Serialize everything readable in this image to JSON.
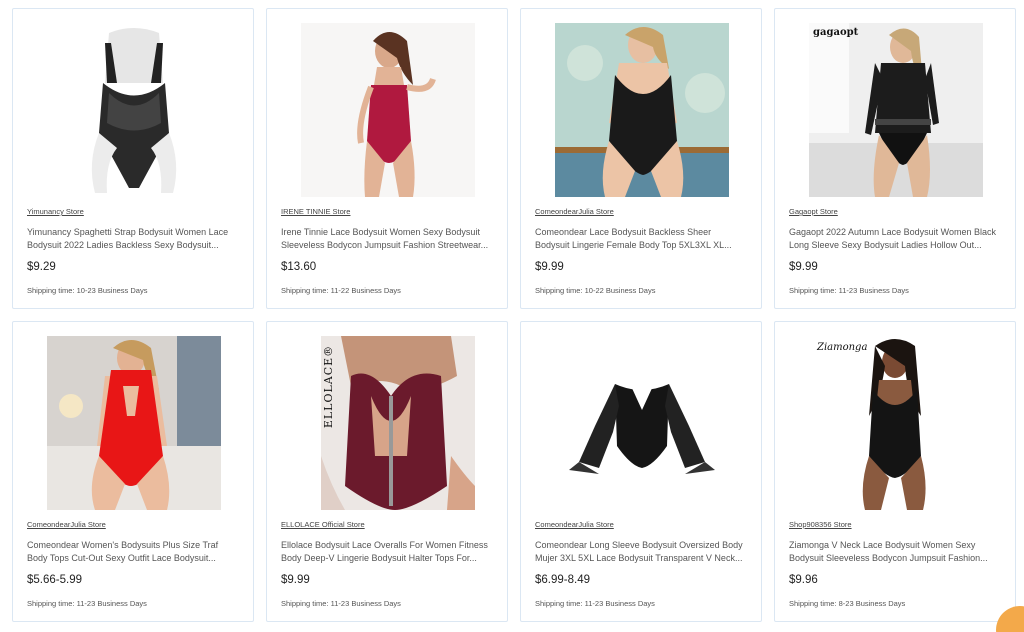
{
  "products": [
    {
      "store": "Yimunancy Store",
      "title": "Yimunancy Spaghetti Strap Bodysuit Women Lace Bodysuit 2022 Ladies Backless Sexy Bodysuit...",
      "price": "$9.29",
      "shipping": "Shipping time: 10-23 Business Days"
    },
    {
      "store": "IRENE TINNIE Store",
      "title": "Irene Tinnie Lace Bodysuit Women Sexy Bodysuit Sleeveless Bodycon Jumpsuit Fashion Streetwear...",
      "price": "$13.60",
      "shipping": "Shipping time: 11-22 Business Days"
    },
    {
      "store": "ComeondearJulia Store",
      "title": "Comeondear Lace Bodysuit Backless Sheer Bodysuit Lingerie Female Body Top 5XL3XL XL...",
      "price": "$9.99",
      "shipping": "Shipping time: 10-22 Business Days"
    },
    {
      "store": "Gagaopt Store",
      "title": "Gagaopt 2022 Autumn Lace Bodysuit Women Black Long Sleeve Sexy Bodysuit Ladies Hollow Out...",
      "price": "$9.99",
      "shipping": "Shipping time: 11-23 Business Days",
      "logo": "gagaopt"
    },
    {
      "store": "ComeondearJulia Store",
      "title": "Comeondear Women's Bodysuits Plus Size Traf Body Tops Cut-Out Sexy Outfit Lace Bodysuit...",
      "price": "$5.66-5.99",
      "shipping": "Shipping time: 11-23 Business Days"
    },
    {
      "store": "ELLOLACE Official Store",
      "title": "Ellolace Bodysuit Lace Overalls For Women Fitness Body Deep-V Lingerie Bodysuit Halter Tops For...",
      "price": "$9.99",
      "shipping": "Shipping time: 11-23 Business Days",
      "logo": "ELLOLACE®"
    },
    {
      "store": "ComeondearJulia Store",
      "title": "Comeondear Long Sleeve Bodysuit Oversized Body Mujer 3XL 5XL Lace Bodysuit Transparent V Neck...",
      "price": "$6.99-8.49",
      "shipping": "Shipping time: 11-23 Business Days"
    },
    {
      "store": "Shop908356 Store",
      "title": "Ziamonga V Neck Lace Bodysuit Women Sexy Bodysuit Sleeveless Bodycon Jumpsuit Fashion...",
      "price": "$9.96",
      "shipping": "Shipping time: 8-23 Business Days",
      "logo": "Ziamonga"
    }
  ]
}
